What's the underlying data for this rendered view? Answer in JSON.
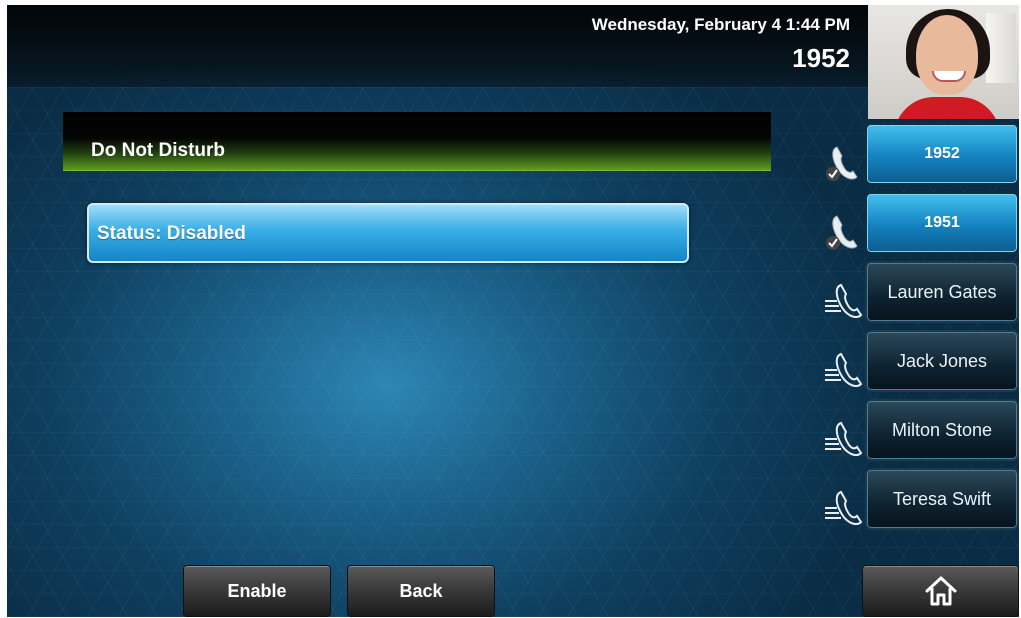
{
  "header": {
    "datetime": "Wednesday, February 4  1:44 PM",
    "extension": "1952"
  },
  "main": {
    "title": "Do Not Disturb",
    "status_item": "Status: Disabled"
  },
  "line_keys": [
    {
      "label": "1952",
      "active": true,
      "icon": "registered-line-icon"
    },
    {
      "label": "1951",
      "active": true,
      "icon": "registered-line-icon"
    },
    {
      "label": "Lauren Gates",
      "active": false,
      "icon": "contact-line-icon"
    },
    {
      "label": "Jack Jones",
      "active": false,
      "icon": "contact-line-icon"
    },
    {
      "label": "Milton Stone",
      "active": false,
      "icon": "contact-line-icon"
    },
    {
      "label": "Teresa Swift",
      "active": false,
      "icon": "contact-line-icon"
    }
  ],
  "softkeys": {
    "enable": "Enable",
    "back": "Back",
    "home_icon": "home-icon"
  },
  "colors": {
    "accent_blue": "#1685c6",
    "title_green": "#5f9b1f",
    "background": "#1a5e86"
  }
}
